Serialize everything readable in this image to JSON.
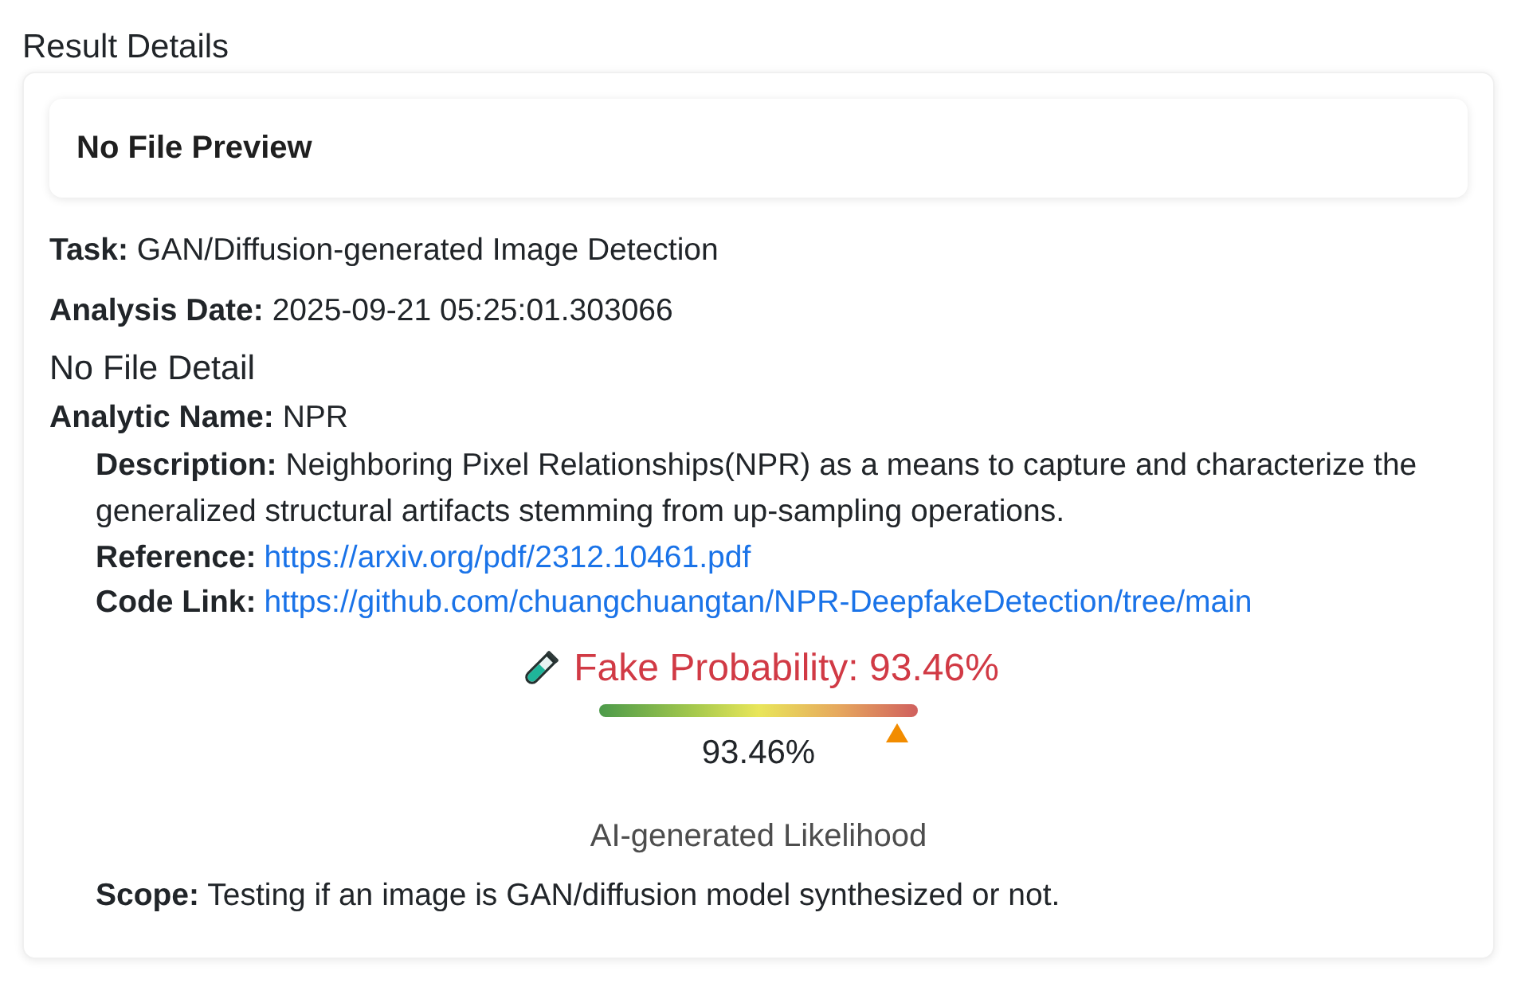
{
  "title": "Result Details",
  "preview": {
    "text": "No File Preview"
  },
  "fields": [
    {
      "label": "Task:",
      "value": "GAN/Diffusion-generated Image Detection"
    },
    {
      "label": "Analysis Date:",
      "value": "2025-09-21 05:25:01.303066"
    }
  ],
  "file_detail": "No File Detail",
  "analytic": {
    "label": "Analytic Name:",
    "value": "NPR",
    "details": [
      {
        "kind": "text",
        "label": "Description:",
        "value": "Neighboring Pixel Relationships(NPR) as a means to capture and characterize the generalized structural artifacts stemming from up-sampling operations."
      },
      {
        "kind": "link",
        "label": "Reference:",
        "value": "https://arxiv.org/pdf/2312.10461.pdf"
      },
      {
        "kind": "link",
        "label": "Code Link:",
        "value": "https://github.com/chuangchuangtan/NPR-DeepfakeDetection/tree/main"
      }
    ],
    "result": {
      "heading": "Fake Probability: 93.46%",
      "level": 0.9346,
      "reading": "93.46%",
      "caption": "AI-generated Likelihood"
    },
    "scope": {
      "label": "Scope:",
      "value": "Testing if an image is GAN/diffusion model synthesized or not."
    }
  }
}
